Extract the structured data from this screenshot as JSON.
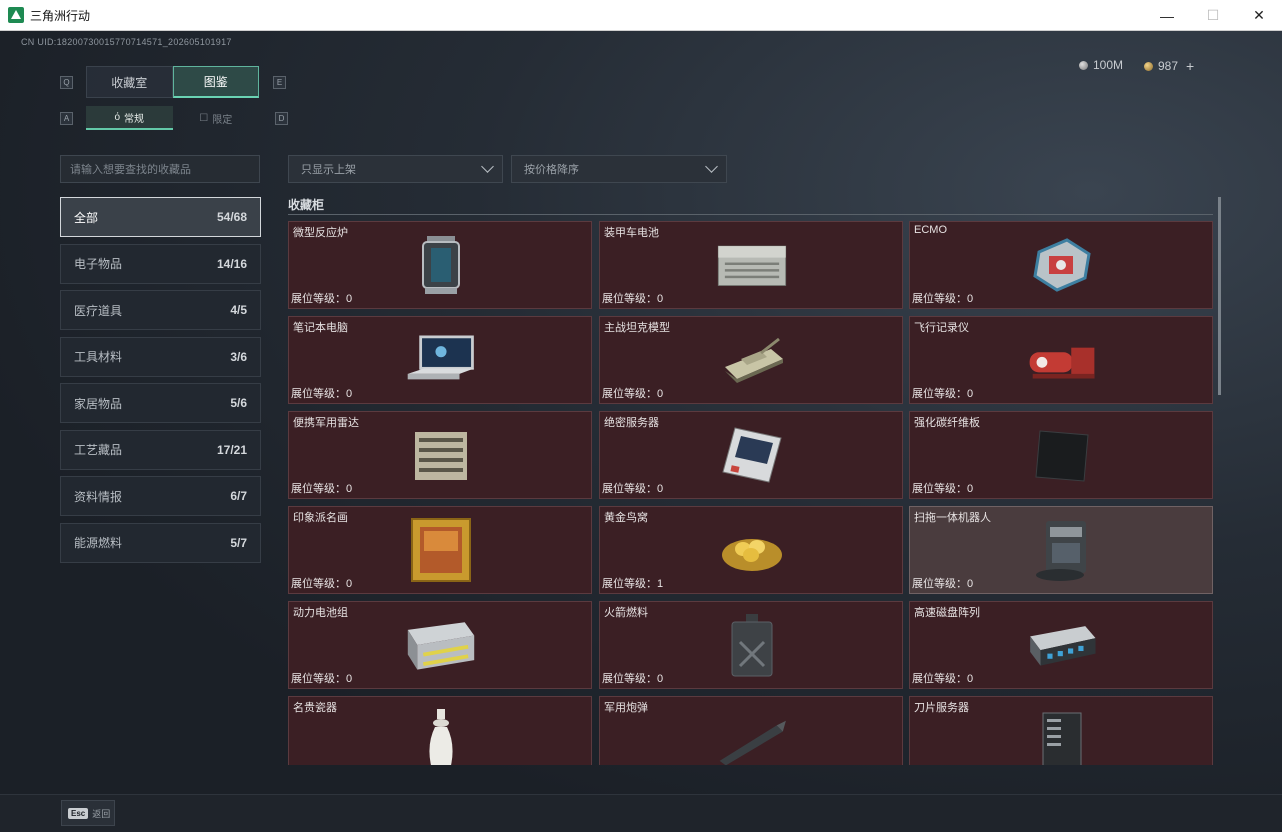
{
  "window": {
    "title": "三角洲行动",
    "minimize": "—",
    "maximize": "☐",
    "close": "✕"
  },
  "uid": "CN UID:18200730015770714571_202605101917",
  "currency": {
    "silver": "100M",
    "gold": "987",
    "plus": "+"
  },
  "keys": {
    "q": "Q",
    "e": "E",
    "a": "A",
    "d": "D"
  },
  "main_tabs": [
    {
      "label": "收藏室"
    },
    {
      "label": "图鉴"
    }
  ],
  "sub_tabs": [
    {
      "label": "常规"
    },
    {
      "label": "限定"
    }
  ],
  "search": {
    "placeholder": "请输入想要查找的收藏品"
  },
  "filters": {
    "shelf": "只显示上架",
    "sort": "按价格降序"
  },
  "categories": [
    {
      "label": "全部",
      "count": "54/68"
    },
    {
      "label": "电子物品",
      "count": "14/16"
    },
    {
      "label": "医疗道具",
      "count": "4/5"
    },
    {
      "label": "工具材料",
      "count": "3/6"
    },
    {
      "label": "家居物品",
      "count": "5/6"
    },
    {
      "label": "工艺藏品",
      "count": "17/21"
    },
    {
      "label": "资料情报",
      "count": "6/7"
    },
    {
      "label": "能源燃料",
      "count": "5/7"
    }
  ],
  "section_title": "收藏柜",
  "items": [
    {
      "name": "微型反应炉",
      "level": "展位等级：0",
      "icon": "reactor-icon"
    },
    {
      "name": "装甲车电池",
      "level": "展位等级：0",
      "icon": "battery-icon"
    },
    {
      "name": "ECMO",
      "level": "展位等级：0",
      "icon": "ecmo-icon"
    },
    {
      "name": "笔记本电脑",
      "level": "展位等级：0",
      "icon": "laptop-icon"
    },
    {
      "name": "主战坦克模型",
      "level": "展位等级：0",
      "icon": "tank-icon"
    },
    {
      "name": "飞行记录仪",
      "level": "展位等级：0",
      "icon": "flight-recorder-icon"
    },
    {
      "name": "便携军用雷达",
      "level": "展位等级：0",
      "icon": "radar-icon"
    },
    {
      "name": "绝密服务器",
      "level": "展位等级：0",
      "icon": "server-board-icon"
    },
    {
      "name": "强化碳纤维板",
      "level": "展位等级：0",
      "icon": "carbon-plate-icon"
    },
    {
      "name": "印象派名画",
      "level": "展位等级：0",
      "icon": "painting-icon"
    },
    {
      "name": "黄金鸟窝",
      "level": "展位等级：1",
      "icon": "golden-nest-icon"
    },
    {
      "name": "扫拖一体机器人",
      "level": "展位等级：0",
      "icon": "robot-vacuum-icon"
    },
    {
      "name": "动力电池组",
      "level": "展位等级：0",
      "icon": "battery-pack-icon"
    },
    {
      "name": "火箭燃料",
      "level": "展位等级：0",
      "icon": "fuel-can-icon"
    },
    {
      "name": "高速磁盘阵列",
      "level": "展位等级：0",
      "icon": "disk-array-icon"
    },
    {
      "name": "名贵瓷器",
      "level": "",
      "icon": "vase-icon"
    },
    {
      "name": "军用炮弹",
      "level": "",
      "icon": "shell-icon"
    },
    {
      "name": "刀片服务器",
      "level": "",
      "icon": "blade-server-icon"
    }
  ],
  "bottom": {
    "esc_key": "Esc",
    "esc_label": "返回"
  }
}
